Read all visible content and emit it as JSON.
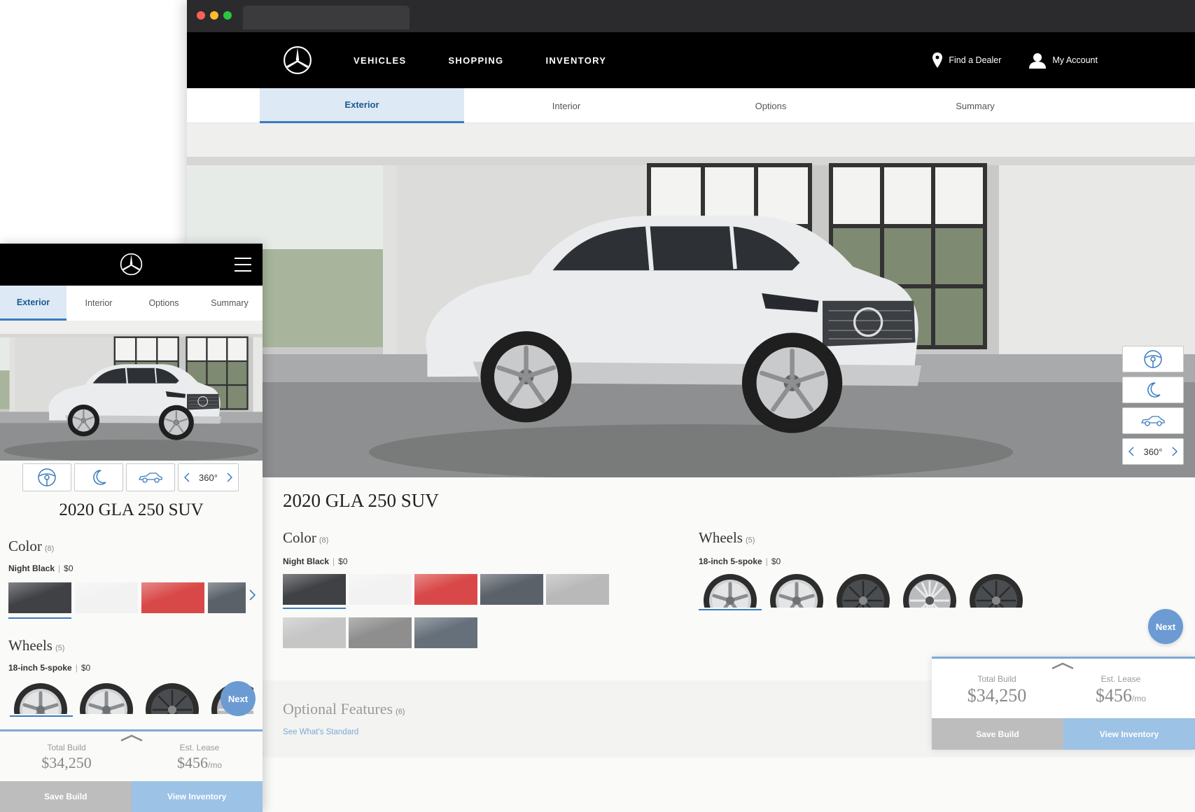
{
  "desktop": {
    "nav": {
      "links": [
        "VEHICLES",
        "SHOPPING",
        "INVENTORY"
      ],
      "find_dealer": "Find a Dealer",
      "my_account": "My Account"
    },
    "tabs": [
      "Exterior",
      "Interior",
      "Options",
      "Summary"
    ],
    "active_tab": "Exterior",
    "view_buttons": {
      "three_sixty": "360°"
    },
    "model": "2020 GLA 250 SUV",
    "color": {
      "title": "Color",
      "count": "(8)",
      "selected_name": "Night Black",
      "selected_price": "$0"
    },
    "swatches": [
      "#3f4145",
      "#f2f2f2",
      "#d94848",
      "#5a6169",
      "#b9b9b9",
      "#c6c6c6",
      "#8e8e8e",
      "#66707a"
    ],
    "wheels": {
      "title": "Wheels",
      "count": "(5)",
      "selected_name": "18-inch 5-spoke",
      "selected_price": "$0"
    },
    "next": "Next",
    "optional": {
      "title": "Optional Features",
      "count": "(6)",
      "link": "See What's Standard"
    },
    "summary": {
      "total_label": "Total Build",
      "total": "$34,250",
      "lease_label": "Est. Lease",
      "lease": "$456",
      "lease_unit": "/mo",
      "save": "Save Build",
      "inventory": "View Inventory"
    }
  },
  "mobile": {
    "tabs": [
      "Exterior",
      "Interior",
      "Options",
      "Summary"
    ],
    "active_tab": "Exterior",
    "three_sixty": "360°",
    "model": "2020 GLA 250 SUV",
    "color": {
      "title": "Color",
      "count": "(8)",
      "selected_name": "Night Black",
      "selected_price": "$0"
    },
    "wheels": {
      "title": "Wheels",
      "count": "(5)",
      "selected_name": "18-inch 5-spoke",
      "selected_price": "$0"
    },
    "next": "Next",
    "summary": {
      "total_label": "Total Build",
      "total": "$34,250",
      "lease_label": "Est. Lease",
      "lease": "$456",
      "lease_unit": "/mo",
      "save": "Save Build",
      "inventory": "View Inventory"
    }
  },
  "colors": {
    "accent": "#3a7bbf",
    "next_bg": "#6b9bd2",
    "inventory_btn": "#9cc2e6",
    "save_btn": "#bdbdbd"
  }
}
